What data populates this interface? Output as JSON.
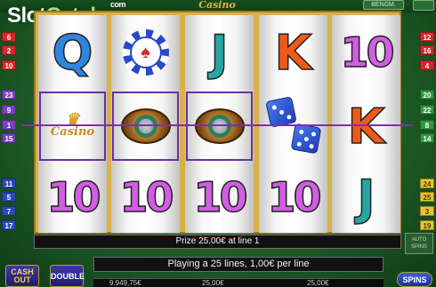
{
  "header": {
    "logo_slot": "Slot",
    "logo_catalog": "Catalog",
    "logo_com": "com",
    "game_title": "Casino",
    "bengm_label": "BENGM."
  },
  "paylines": {
    "left": [
      "6",
      "2",
      "10",
      "23",
      "9",
      "1",
      "15",
      "11",
      "5",
      "7",
      "17"
    ],
    "right": [
      "12",
      "16",
      "4",
      "20",
      "22",
      "8",
      "14",
      "24",
      "25",
      "3",
      "19"
    ]
  },
  "reels": [
    [
      "Q",
      "chip",
      "10"
    ],
    [
      "chip2",
      "roulette",
      "10"
    ],
    [
      "J",
      "roulette",
      "10"
    ],
    [
      "K",
      "dice",
      "10"
    ],
    [
      "10",
      "K",
      "J"
    ]
  ],
  "symbols": {
    "crown_casino": "Casino",
    "chip_suit": "♠"
  },
  "status": {
    "prize_text": "Prize 25,00€ at line 1",
    "info_text": "Playing a 25 lines, 1,00€ per line",
    "credit": "9.949,75€",
    "bet": "25,00€",
    "win": "25,00€"
  },
  "buttons": {
    "cash_out": "CASH OUT",
    "double": "DOUBLE",
    "spins": "SPINS",
    "auto": "AUTO SPINS"
  },
  "colors": {
    "background": "#1f5e28",
    "frame": "#d8b24a",
    "winline": "#7a2fb8"
  }
}
